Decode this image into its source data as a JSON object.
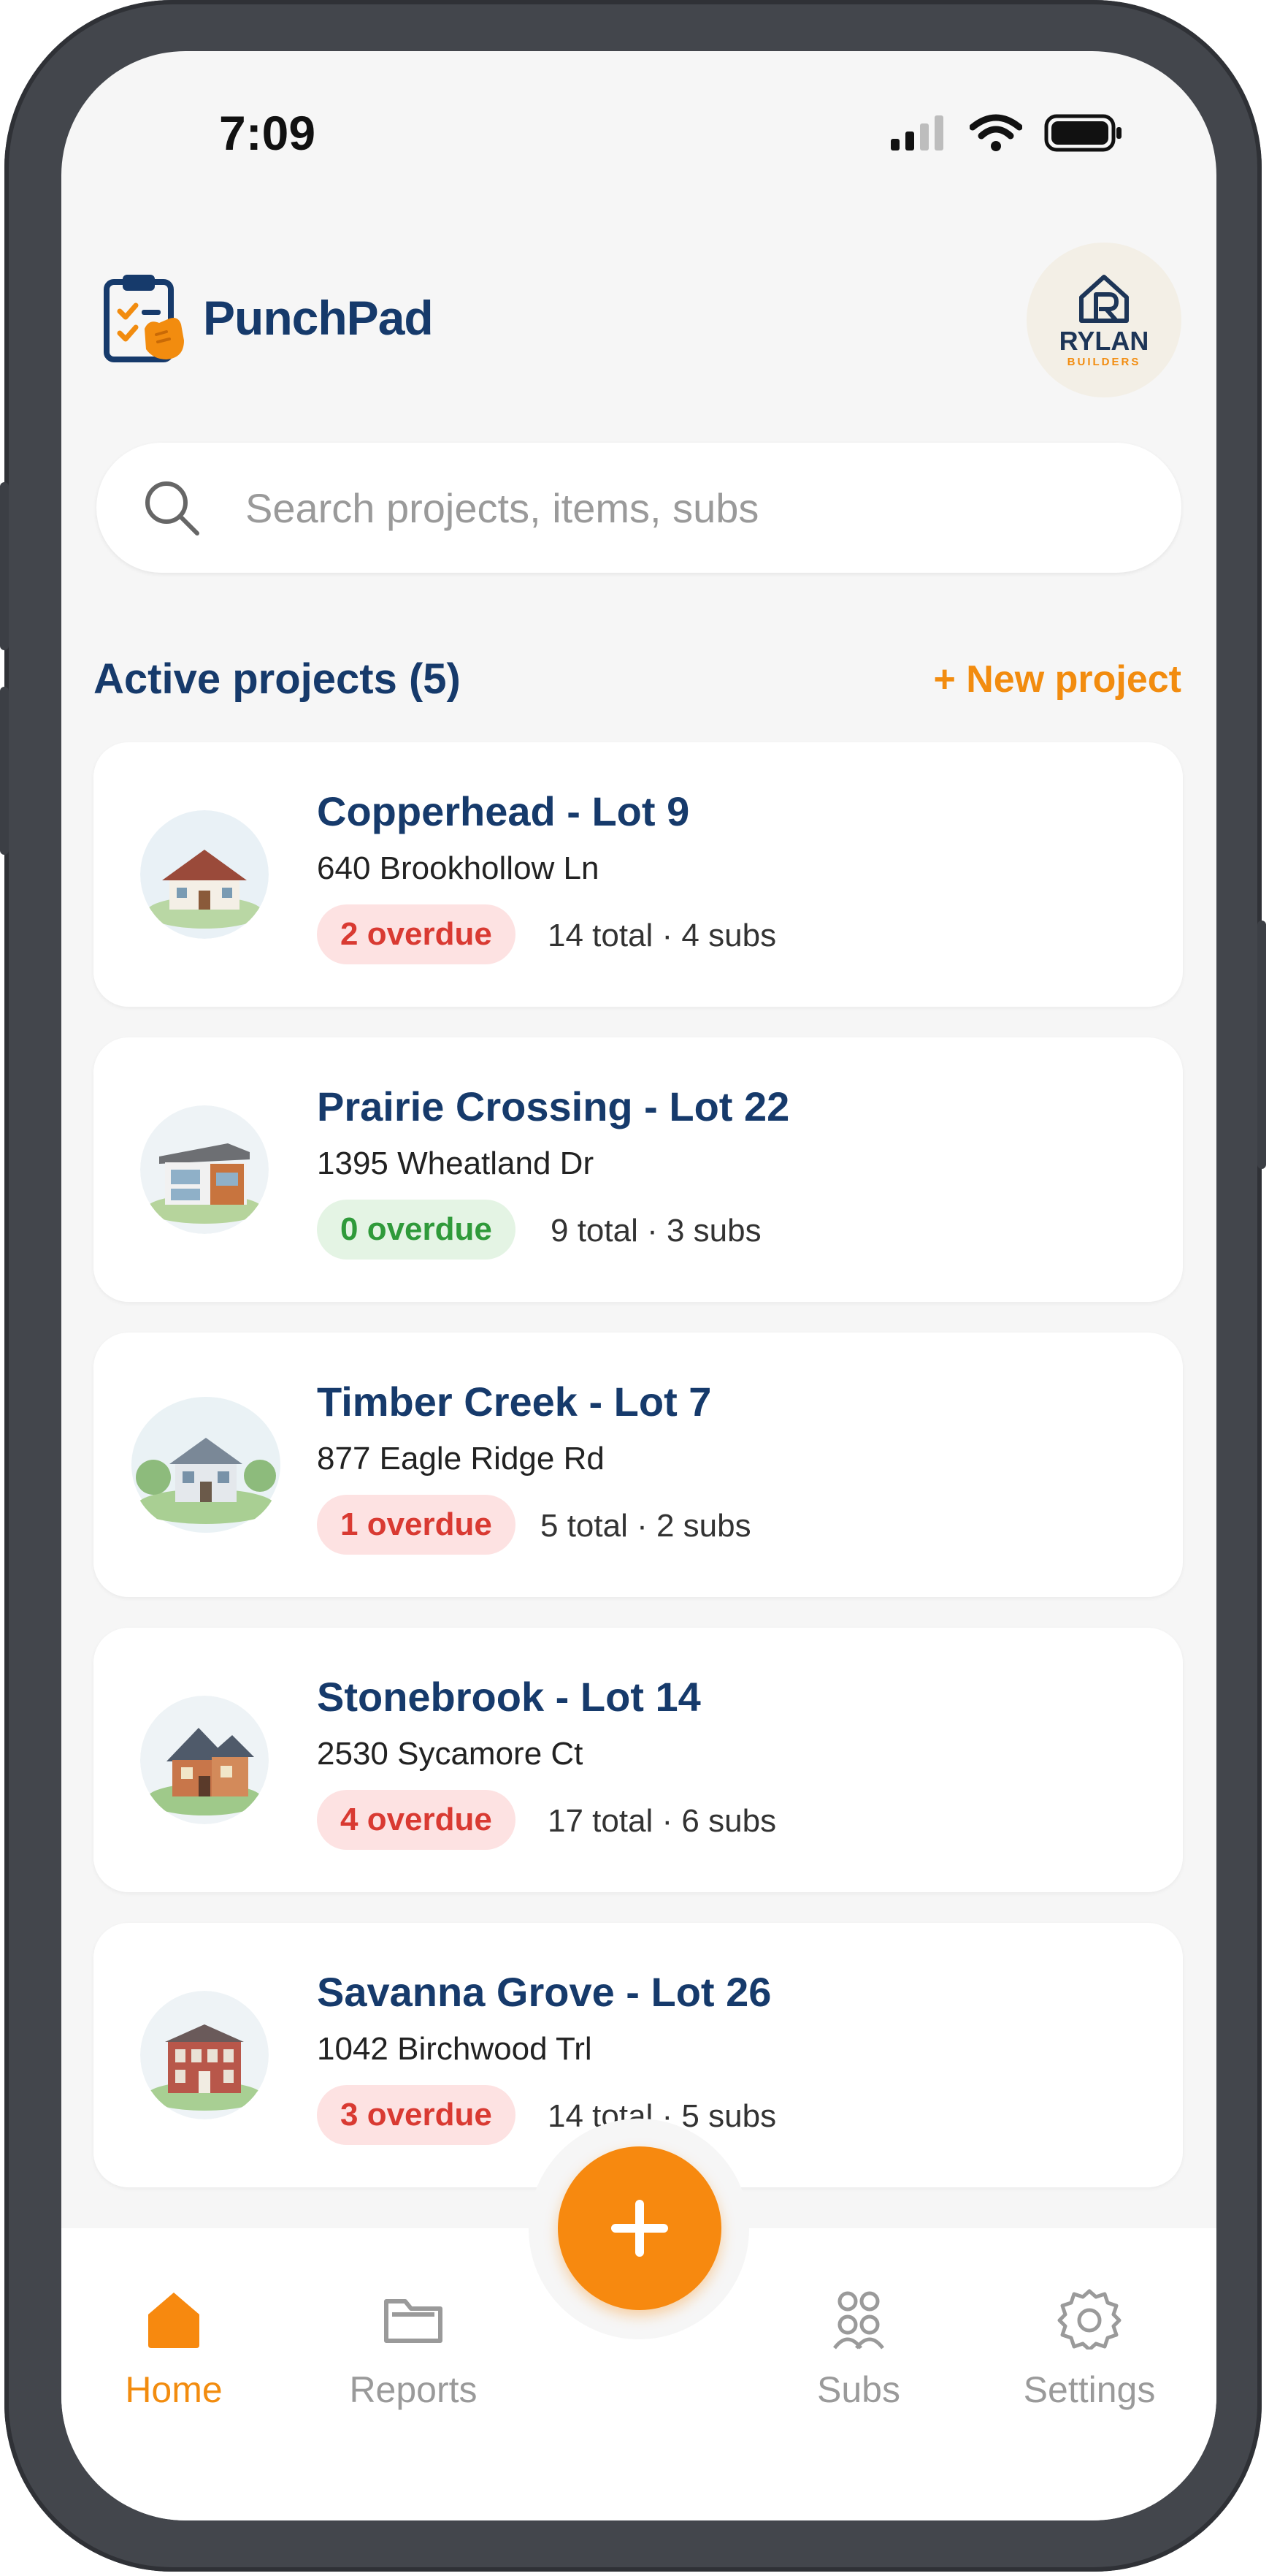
{
  "status_bar": {
    "time": "7:09"
  },
  "header": {
    "app_name": "PunchPad",
    "company": {
      "name": "RYLAN",
      "subtitle": "BUILDERS"
    }
  },
  "search": {
    "placeholder": "Search projects, items, subs",
    "value": ""
  },
  "section": {
    "title": "Active projects (5)",
    "new_project_label": "+ New project"
  },
  "projects": [
    {
      "name": "Copperhead - Lot 9",
      "address": "640 Brookhollow Ln",
      "overdue_label": "2 overdue",
      "overdue_status": "red",
      "stats": "14 total · 4 subs"
    },
    {
      "name": "Prairie Crossing - Lot 22",
      "address": "1395 Wheatland Dr",
      "overdue_label": "0 overdue",
      "overdue_status": "green",
      "stats": "9 total · 3 subs"
    },
    {
      "name": "Timber Creek - Lot 7",
      "address": "877 Eagle Ridge Rd",
      "overdue_label": "1 overdue",
      "overdue_status": "red",
      "stats": "5 total · 2 subs"
    },
    {
      "name": "Stonebrook - Lot 14",
      "address": "2530 Sycamore Ct",
      "overdue_label": "4 overdue",
      "overdue_status": "red",
      "stats": "17 total · 6 subs"
    },
    {
      "name": "Savanna Grove - Lot 26",
      "address": "1042 Birchwood Trl",
      "overdue_label": "3 overdue",
      "overdue_status": "red",
      "stats": "14 total · 5 subs"
    }
  ],
  "bottom_nav": {
    "items": [
      {
        "label": "Home",
        "icon": "home-icon",
        "active": true
      },
      {
        "label": "Reports",
        "icon": "folder-icon",
        "active": false
      },
      {
        "label": "Subs",
        "icon": "people-icon",
        "active": false
      },
      {
        "label": "Settings",
        "icon": "gear-icon",
        "active": false
      }
    ],
    "fab_icon": "plus-icon"
  },
  "colors": {
    "accent": "#f7890f",
    "brand_navy": "#163a6b",
    "overdue_red": "#d93a32",
    "ok_green": "#2f9a3a"
  }
}
